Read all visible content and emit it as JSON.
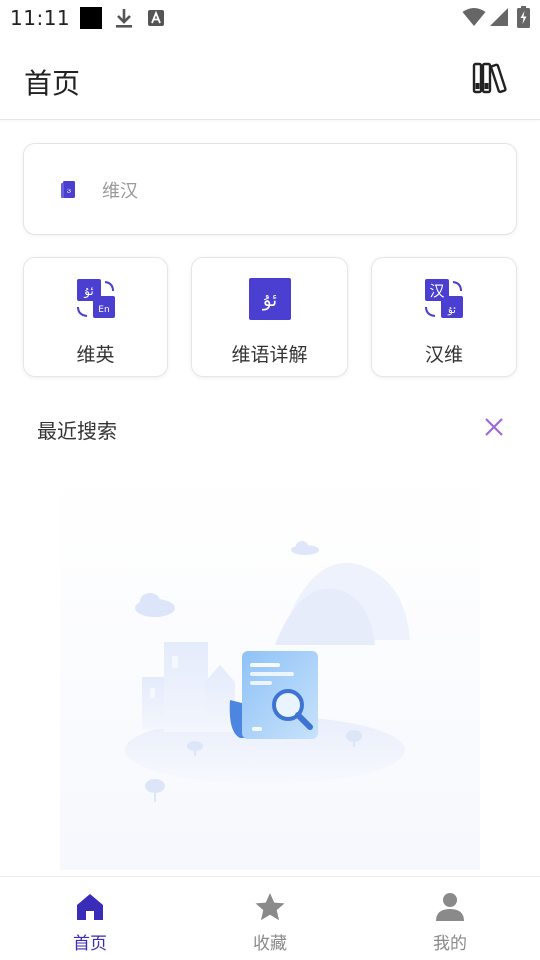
{
  "status_bar": {
    "time": "11:11"
  },
  "header": {
    "title": "首页",
    "library_icon": "library-books-icon"
  },
  "search": {
    "placeholder": "维汉",
    "icon": "book-icon"
  },
  "features": [
    {
      "label": "维英",
      "icon": "translate-uyghur-english-icon",
      "badge_top": "ئۇ",
      "badge_bottom": "En"
    },
    {
      "label": "维语详解",
      "icon": "uyghur-dictionary-icon",
      "badge_top": "ئۇ"
    },
    {
      "label": "汉维",
      "icon": "translate-chinese-uyghur-icon",
      "badge_top": "汉",
      "badge_bottom": "ئۇ"
    }
  ],
  "recent": {
    "title": "最近搜索",
    "clear_icon": "close-icon"
  },
  "bottom_nav": {
    "items": [
      {
        "label": "首页",
        "icon": "home-icon",
        "active": true
      },
      {
        "label": "收藏",
        "icon": "star-icon",
        "active": false
      },
      {
        "label": "我的",
        "icon": "person-icon",
        "active": false
      }
    ]
  },
  "colors": {
    "accent": "#3a2bb8",
    "icon_purple": "#4a3fd0",
    "close_purple": "#9b6bd8",
    "inactive": "#8a8a8a"
  }
}
